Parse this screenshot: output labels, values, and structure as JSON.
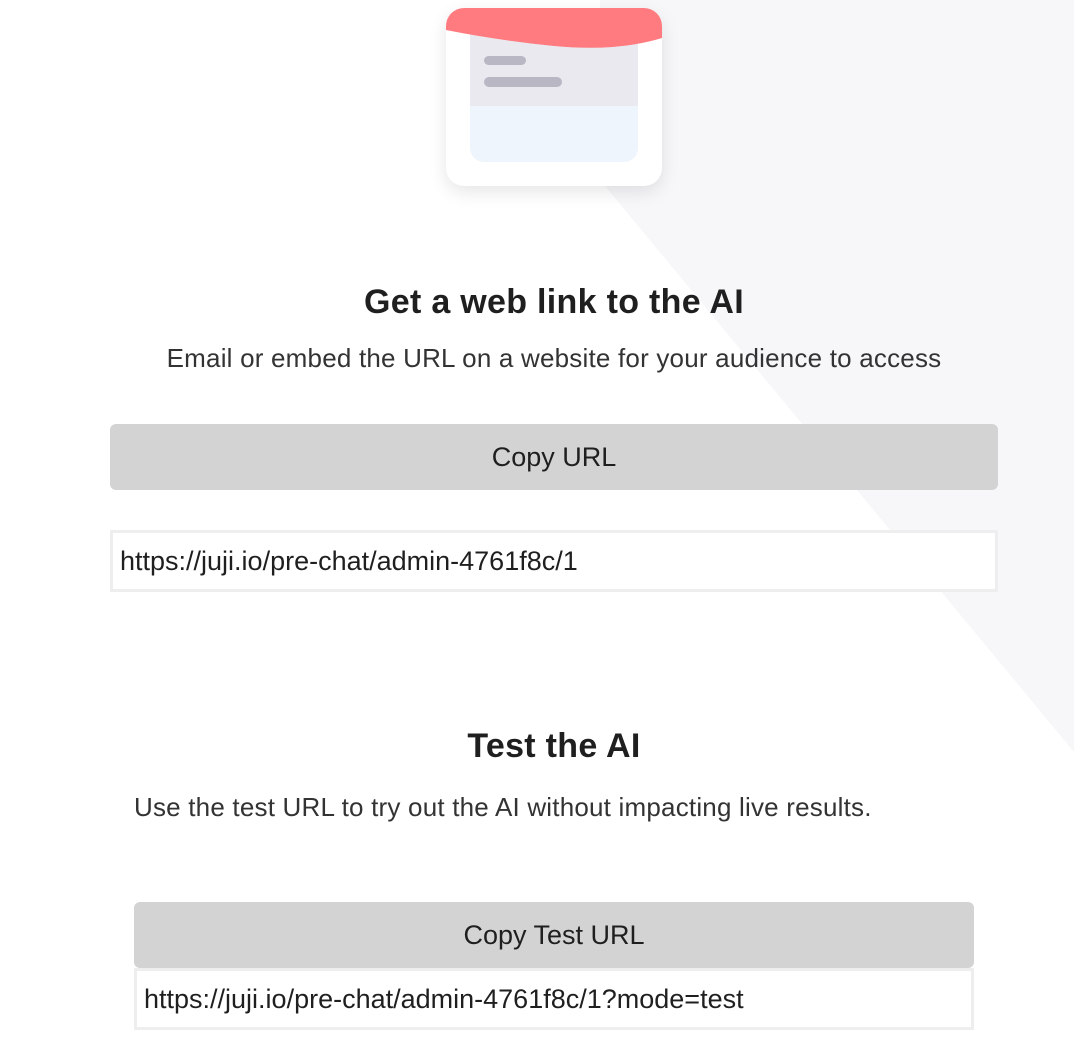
{
  "web_link": {
    "title": "Get a web link to the AI",
    "description": "Email or embed the URL on a website for your audience to access",
    "copy_button_label": "Copy URL",
    "url_value": "https://juji.io/pre-chat/admin-4761f8c/1"
  },
  "test": {
    "title": "Test the AI",
    "description": "Use the test URL to try out the AI without impacting live results.",
    "copy_button_label": "Copy Test URL",
    "url_value": "https://juji.io/pre-chat/admin-4761f8c/1?mode=test"
  },
  "colors": {
    "illustration_header": "#ff7b7f",
    "button_background": "#d3d3d3",
    "background_shape": "#f7f7f9"
  },
  "icons": {
    "illustration": "chat-card-illustration"
  }
}
